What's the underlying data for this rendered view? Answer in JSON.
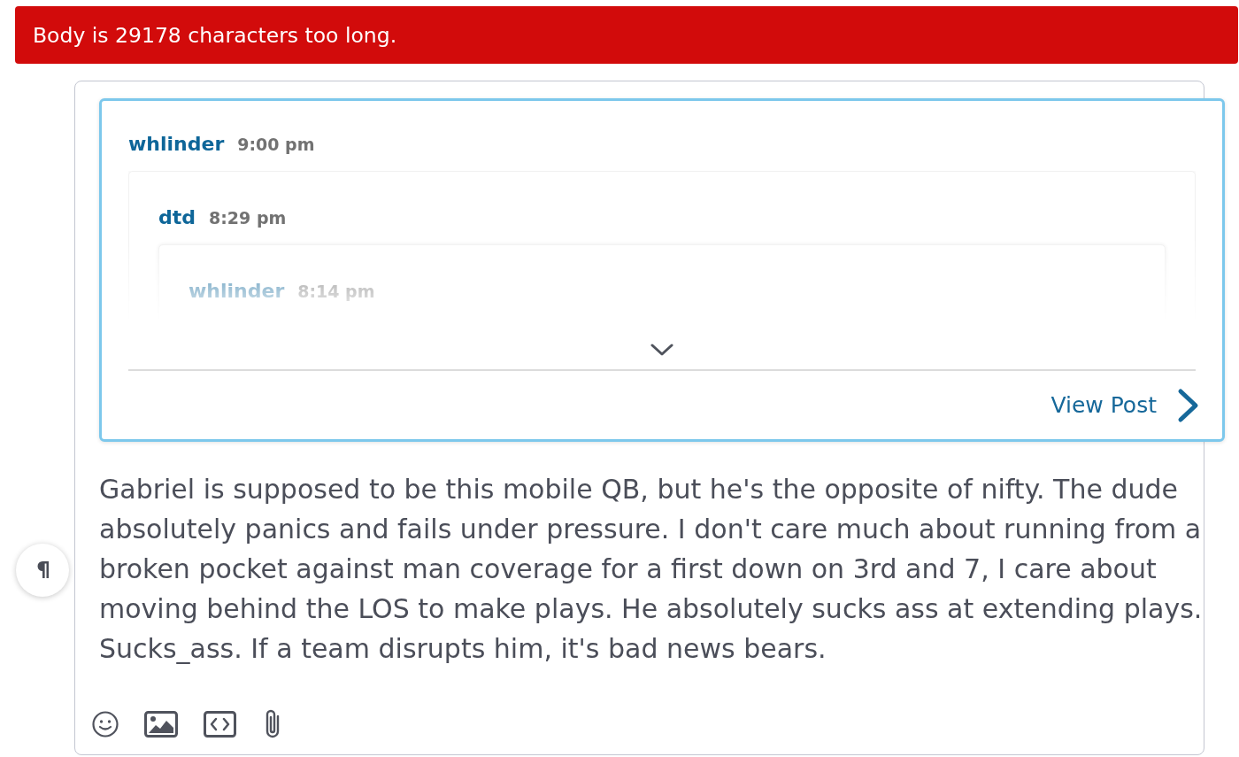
{
  "error_banner": {
    "message": "Body is 29178 characters too long."
  },
  "editor": {
    "quote": {
      "author": "whlinder",
      "time": "9:00 pm",
      "expanded": false,
      "children": [
        {
          "author": "dtd",
          "time": "8:29 pm",
          "children": [
            {
              "author": "whlinder",
              "time": "8:14 pm"
            }
          ]
        }
      ],
      "view_link": "View Post"
    },
    "body": "Gabriel is supposed to be this mobile QB, but he's the opposite of nifty. The dude absolutely panics and fails under pressure. I don't care much about running from a broken pocket against man coverage for a first down on 3rd and 7, I care about moving behind the LOS to make plays. He absolutely sucks ass at extending plays. Sucks_ass. If a team disrupts him, it's bad news bears."
  }
}
